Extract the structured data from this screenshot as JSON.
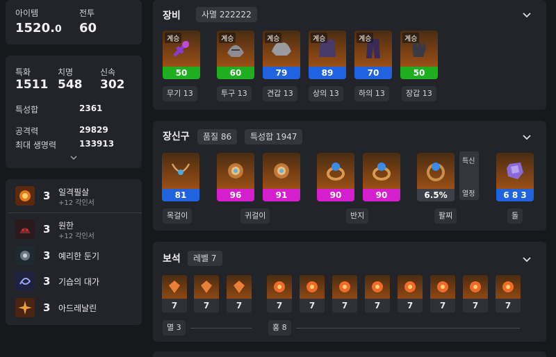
{
  "summary": {
    "item_level_label": "아이템",
    "item_level_main": "1520.",
    "item_level_decimal": "0",
    "combat_label": "전투",
    "combat_value": "60"
  },
  "stats": {
    "specialization_label": "특화",
    "specialization_value": "1511",
    "crit_label": "치명",
    "crit_value": "548",
    "swiftness_label": "신속",
    "swiftness_value": "302",
    "total_label": "특성합",
    "total_value": "2361",
    "attack_label": "공격력",
    "attack_value": "29829",
    "hp_label": "최대 생명력",
    "hp_value": "133913"
  },
  "engravings": [
    {
      "level": "3",
      "name": "일격필살",
      "sub": "+12 각인서",
      "icon": "fire-burst-icon"
    },
    {
      "level": "3",
      "name": "원한",
      "sub": "+12 각인서",
      "icon": "demon-icon"
    },
    {
      "level": "3",
      "name": "예리한 둔기",
      "sub": "",
      "icon": "mace-icon"
    },
    {
      "level": "3",
      "name": "기습의 대가",
      "sub": "",
      "icon": "swirl-icon"
    },
    {
      "level": "3",
      "name": "아드레날린",
      "sub": "",
      "icon": "burst-icon"
    }
  ],
  "equipment": {
    "title": "장비",
    "set_pill": "사멸 222222",
    "tag": "계승",
    "items": [
      {
        "quality": "50",
        "color": "green",
        "label": "무기 13",
        "icon": "weapon-icon"
      },
      {
        "quality": "60",
        "color": "green",
        "label": "투구 13",
        "icon": "helmet-icon"
      },
      {
        "quality": "79",
        "color": "blue",
        "label": "견갑 13",
        "icon": "shoulder-icon"
      },
      {
        "quality": "89",
        "color": "blue",
        "label": "상의 13",
        "icon": "chest-icon"
      },
      {
        "quality": "70",
        "color": "blue",
        "label": "하의 13",
        "icon": "pants-icon"
      },
      {
        "quality": "50",
        "color": "green",
        "label": "장갑 13",
        "icon": "gloves-icon"
      }
    ]
  },
  "accessories": {
    "title": "장신구",
    "quality_pill": "품질 86",
    "stat_pill": "특성합 1947",
    "items": [
      {
        "quality": "81",
        "color": "blue",
        "icon": "necklace-icon"
      },
      {
        "quality": "96",
        "color": "magenta",
        "icon": "earring-icon"
      },
      {
        "quality": "91",
        "color": "magenta",
        "icon": "earring-icon"
      },
      {
        "quality": "90",
        "color": "magenta",
        "icon": "ring-icon"
      },
      {
        "quality": "90",
        "color": "magenta",
        "icon": "ring-icon"
      },
      {
        "quality": "6.5%",
        "color": "grey",
        "icon": "bracelet-icon"
      },
      {
        "quality": "6 8 3",
        "color": "blue",
        "icon": "stone-icon"
      }
    ],
    "labels": [
      "목걸이",
      "귀걸이",
      "반지",
      "팔찌",
      "돌"
    ],
    "bracelet_stats": [
      "특신",
      "열정"
    ]
  },
  "gems": {
    "title": "보석",
    "level_pill": "레벨 7",
    "cooldown": [
      "7",
      "7",
      "7"
    ],
    "damage": [
      "7",
      "7",
      "7",
      "7",
      "7",
      "7",
      "7",
      "7"
    ],
    "cooldown_label": "멸 3",
    "damage_label": "홍 8"
  },
  "colors": {
    "green": "#1fae1f",
    "blue": "#1f63e0",
    "magenta": "#d51fcf",
    "panel": "#22242a"
  }
}
